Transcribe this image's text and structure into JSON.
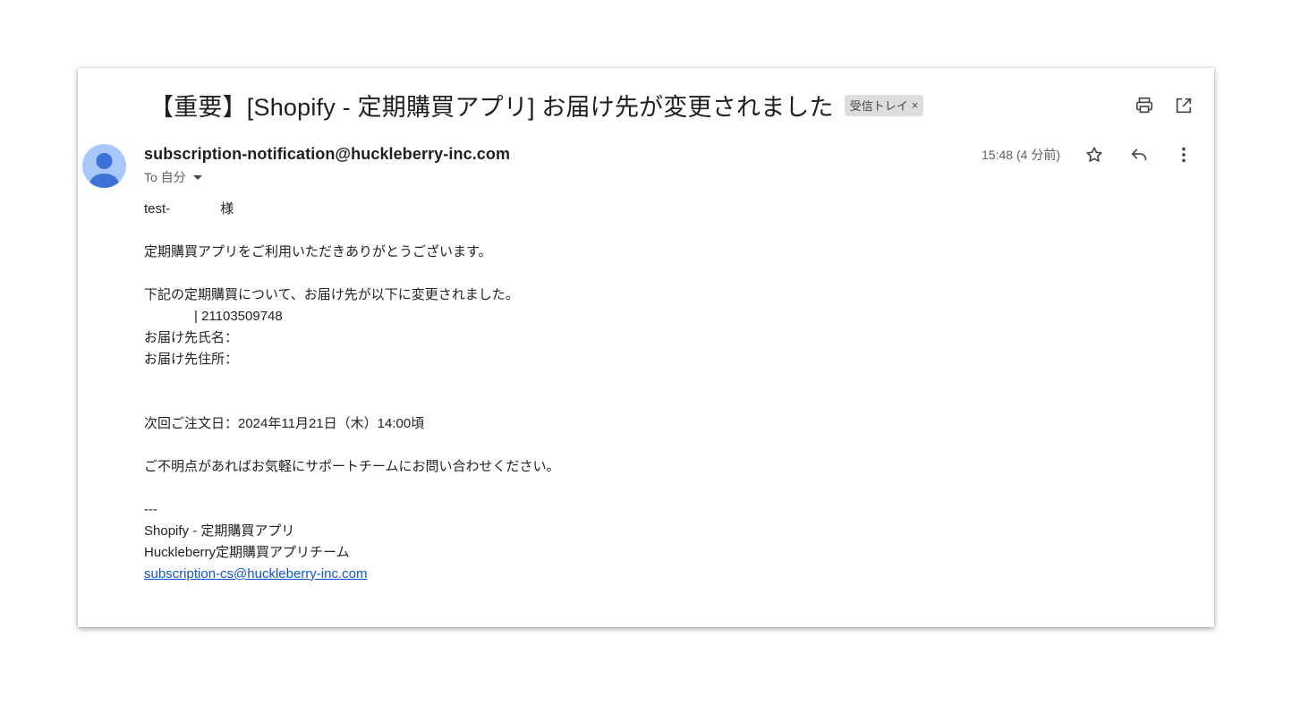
{
  "email": {
    "subject": "【重要】[Shopify - 定期購買アプリ] お届け先が変更されました",
    "label": "受信トレイ",
    "label_close": "×",
    "sender": "subscription-notification@huckleberry-inc.com",
    "to_line": "To 自分",
    "timestamp": "15:48 (4 分前)"
  },
  "icons": {
    "print": "print-icon",
    "open_new_window": "open-in-new-icon",
    "star": "star-icon",
    "reply": "reply-icon",
    "more": "more-vert-icon",
    "avatar": "person-icon"
  },
  "body": {
    "greeting_name": "test-",
    "greeting_suffix": "様",
    "line_thanks": "定期購買アプリをご利用いただきありがとうございます。",
    "line_notice": "下記の定期購買について、お届け先が以下に変更されました。",
    "contract_id": "| 21103509748",
    "recipient_name_label": "お届け先氏名：",
    "recipient_address_label": "お届け先住所：",
    "next_order": "次回ご注文日：2024年11月21日（木）14:00頃",
    "contact_note": "ご不明点があればお気軽にサポートチームにお問い合わせください。",
    "sig_sep": "---",
    "sig_app": "Shopify - 定期購買アプリ",
    "sig_team": "Huckleberry定期購買アプリチーム",
    "sig_email": "subscription-cs@huckleberry-inc.com"
  },
  "colors": {
    "avatar_bg": "#a8c7fa",
    "avatar_fg": "#3d72d6",
    "link": "#1155cc",
    "chip_bg": "#dddddd"
  }
}
